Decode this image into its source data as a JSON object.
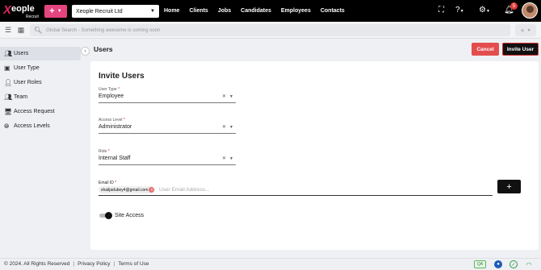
{
  "brand": {
    "logo_mark": "X",
    "logo_word": "eople",
    "logo_sub": "Recruit"
  },
  "topbar": {
    "add_label": "+",
    "company": "Xeople Recruit Ltd",
    "nav": [
      "Home",
      "Clients",
      "Jobs",
      "Candidates",
      "Employees",
      "Contacts"
    ],
    "notification_count": "5"
  },
  "searchbar": {
    "placeholder": "Global Search - Something awesome is coming soon",
    "plus_label": "+"
  },
  "sidebar": {
    "items": [
      {
        "label": "Users",
        "icon": "users-icon",
        "active": true
      },
      {
        "label": "User Type",
        "icon": "user-type-icon"
      },
      {
        "label": "User Roles",
        "icon": "user-roles-icon"
      },
      {
        "label": "Team",
        "icon": "team-icon"
      },
      {
        "label": "Access Request",
        "icon": "monitor-icon"
      },
      {
        "label": "Access Levels",
        "icon": "globe-icon"
      }
    ]
  },
  "header": {
    "title": "Users",
    "cancel_label": "Cancel",
    "invite_label": "Invite User"
  },
  "form": {
    "title": "Invite Users",
    "user_type": {
      "label": "User Type",
      "value": "Employee"
    },
    "access_level": {
      "label": "Access Level",
      "value": "Administrator"
    },
    "role": {
      "label": "Role",
      "value": "Internal Staff"
    },
    "email": {
      "label": "Email ID",
      "chip": "shailjadubey4@gmail.com",
      "placeholder": "User Email Address...",
      "add_label": "+"
    },
    "site_access": {
      "label": "Site Access",
      "on": true
    }
  },
  "footer": {
    "copyright": "© 2024. All Rights Reserved",
    "privacy": "Privacy Policy",
    "terms": "Terms of Use",
    "qa_badge": "QA"
  },
  "colors": {
    "accent_pink": "#e5447e",
    "cancel_red": "#e34d4d",
    "invite_border": "#d32f2f"
  }
}
